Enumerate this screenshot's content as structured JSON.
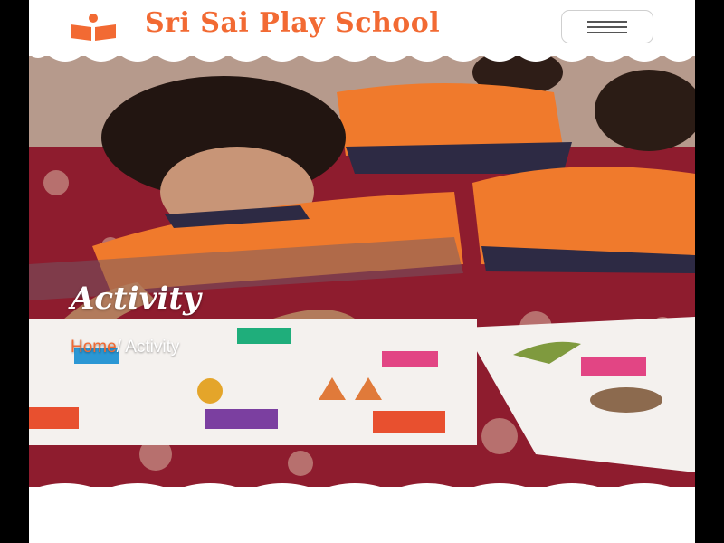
{
  "header": {
    "brand_name": "Sri Sai Play School",
    "logo_icon": "book-reader-icon",
    "menu_icon": "hamburger-icon"
  },
  "hero": {
    "title": "Activity",
    "breadcrumb": {
      "home": "Home",
      "separator": "/ ",
      "current": "Activity"
    }
  },
  "colors": {
    "brand": "#f26a33",
    "white": "#ffffff"
  }
}
